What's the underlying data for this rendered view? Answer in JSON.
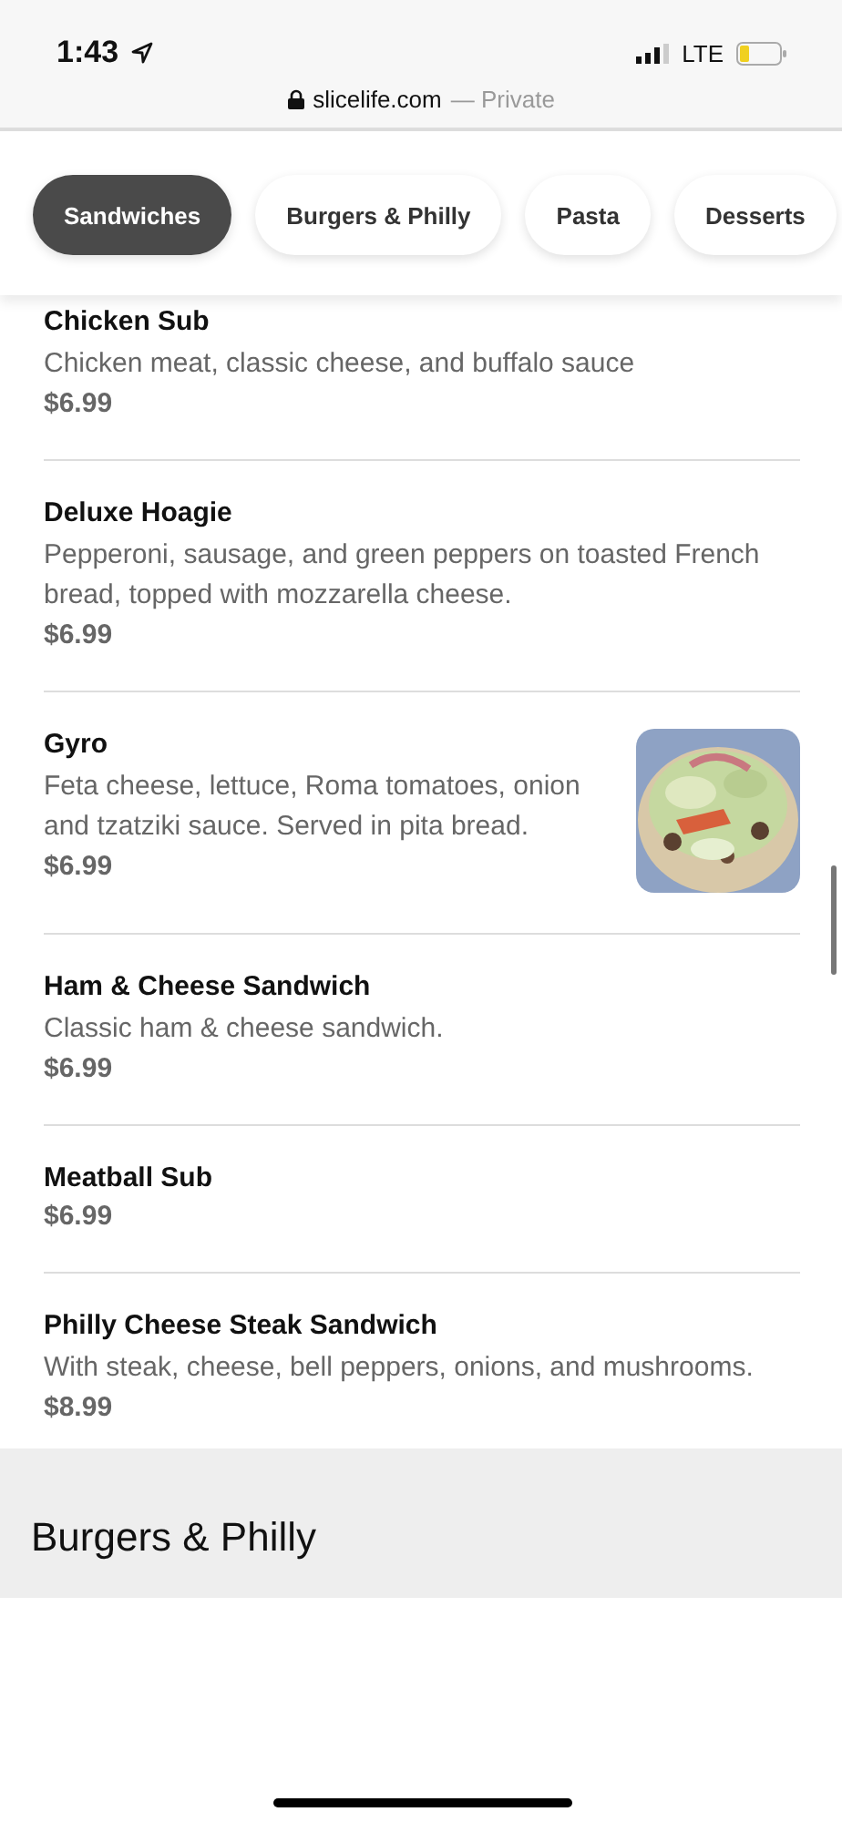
{
  "status_bar": {
    "time": "1:43",
    "network": "LTE"
  },
  "address_bar": {
    "domain": "slicelife.com",
    "mode": "— Private"
  },
  "tabs": [
    {
      "label": "Sandwiches",
      "selected": true
    },
    {
      "label": "Burgers & Philly",
      "selected": false
    },
    {
      "label": "Pasta",
      "selected": false
    },
    {
      "label": "Desserts",
      "selected": false
    }
  ],
  "items": [
    {
      "name": "Chicken Sub",
      "description": "Chicken meat, classic cheese, and buffalo sauce",
      "price": "$6.99"
    },
    {
      "name": "Deluxe Hoagie",
      "description": "Pepperoni, sausage, and green peppers on toasted French bread, topped with mozzarella cheese.",
      "price": "$6.99"
    },
    {
      "name": "Gyro",
      "description": "Feta cheese, lettuce, Roma tomatoes, onion and tzatziki sauce. Served in pita bread.",
      "price": "$6.99"
    },
    {
      "name": "Ham & Cheese Sandwich",
      "description": "Classic ham & cheese sandwich.",
      "price": "$6.99"
    },
    {
      "name": "Meatball Sub",
      "price": "$6.99"
    },
    {
      "name": "Philly Cheese Steak Sandwich",
      "description": "With steak, cheese, bell peppers, onions, and mushrooms.",
      "price": "$8.99"
    }
  ],
  "next_section": {
    "title": "Burgers & Philly"
  }
}
